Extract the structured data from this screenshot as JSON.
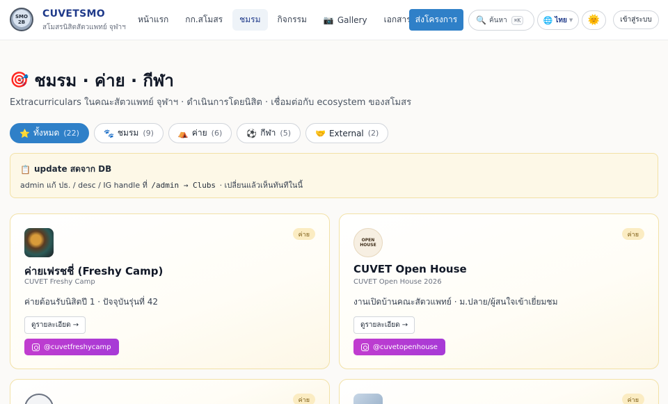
{
  "header": {
    "brand_title": "CUVETSMO",
    "brand_sub": "สโมสรนิสิตสัตวแพทย์ จุฬาฯ",
    "logo_text": "SMO\n2B",
    "nav": [
      {
        "label": "หน้าแรก",
        "icon": "",
        "active": false
      },
      {
        "label": "กก.สโมสร",
        "icon": "",
        "active": false
      },
      {
        "label": "ชมรม",
        "icon": "",
        "active": true
      },
      {
        "label": "กิจกรรม",
        "icon": "",
        "active": false
      },
      {
        "label": "Gallery",
        "icon": "📷",
        "active": false
      },
      {
        "label": "เอกสาร",
        "icon": "",
        "active": false
      }
    ],
    "project_button": "ส่งโครงการ",
    "search": {
      "icon": "search-icon",
      "placeholder": "ค้นหา",
      "shortcut": "⌘K"
    },
    "language": {
      "icon": "globe-icon",
      "label": "ไทย"
    },
    "theme_icon": "sun-icon",
    "login_button": "เข้าสู่ระบบ"
  },
  "page": {
    "title": "ชมรม · ค่าย · กีฬา",
    "title_icon": "dart-icon",
    "subtitle": "Extracurriculars ในคณะสัตวแพทย์ จุฬาฯ · ดำเนินการโดยนิสิต · เชื่อมต่อกับ ecosystem ของสโมสร"
  },
  "filters": [
    {
      "icon": "⭐",
      "label": "ทั้งหมด",
      "count": "(22)",
      "active": true
    },
    {
      "icon": "🐾",
      "label": "ชมรม",
      "count": "(9)",
      "active": false
    },
    {
      "icon": "⛺",
      "label": "ค่าย",
      "count": "(6)",
      "active": false
    },
    {
      "icon": "⚽",
      "label": "กีฬา",
      "count": "(5)",
      "active": false
    },
    {
      "icon": "🤝",
      "label": "External",
      "count": "(2)",
      "active": false
    }
  ],
  "notice": {
    "title": "update สดจาก DB",
    "body_prefix": "admin แก้ ปธ. / desc / IG handle ที่",
    "body_code": "/admin → Clubs",
    "body_suffix": "· เปลี่ยนแล้วเห็นทันทีในนี้"
  },
  "cards": [
    {
      "tag": "ค่าย",
      "title": "ค่ายเฟรชชี่ (Freshy Camp)",
      "sub": "CUVET Freshy Camp",
      "desc": "ค่ายต้อนรับนิสิตปี 1 · ปัจจุบันรุ่นที่ 42",
      "detail": "ดูรายละเอียด →",
      "ig": "@cuvetfreshycamp"
    },
    {
      "tag": "ค่าย",
      "title": "CUVET Open House",
      "sub": "CUVET Open House 2026",
      "desc": "งานเปิดบ้านคณะสัตวแพทย์ · ม.ปลาย/ผู้สนใจเข้าเยี่ยมชม",
      "detail": "ดูรายละเอียด →",
      "ig": "@cuvetopenhouse",
      "logo_text": "OPEN\nHOUSE"
    },
    {
      "tag": "ค่าย"
    },
    {
      "tag": "ค่าย"
    }
  ]
}
